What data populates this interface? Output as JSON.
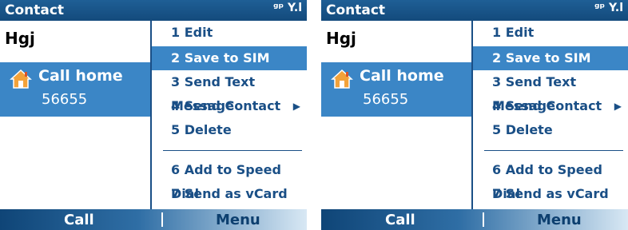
{
  "screens": [
    {
      "title": "Contact",
      "status": "ᵍᵖ Y.l",
      "contact_name": "Hgj",
      "selected_field": {
        "label": "Call home",
        "value": "56655",
        "icon": "home-icon"
      },
      "menu": {
        "items": [
          {
            "label": "1 Edit"
          },
          {
            "label": "2 Save to SIM"
          },
          {
            "label": "3 Send Text Message"
          },
          {
            "label": "4 Send Contact"
          },
          {
            "label": "5 Delete"
          },
          {
            "label": "6 Add to Speed Dial"
          },
          {
            "label": "7 Send as vCard"
          }
        ],
        "selected_index": 1
      },
      "softkeys": {
        "left": "Call",
        "right": "Menu"
      }
    },
    {
      "title": "Contact",
      "status": "ᵍᵖ Y.l",
      "contact_name": "Hgj",
      "selected_field": {
        "label": "Call home",
        "value": "56655",
        "icon": "home-icon"
      },
      "menu": {
        "items": [
          {
            "label": "1 Edit"
          },
          {
            "label": "2 Save to SIM"
          },
          {
            "label": "3 Send Text Message"
          },
          {
            "label": "4 Send Contact"
          },
          {
            "label": "5 Delete"
          },
          {
            "label": "6 Add to Speed Dial"
          },
          {
            "label": "7 Send as vCard"
          }
        ],
        "selected_index": 1
      },
      "softkeys": {
        "left": "Call",
        "right": "Menu"
      }
    }
  ],
  "colors": {
    "titlebar": "#134a7c",
    "highlight": "#3b86c6",
    "menu_text": "#1a4f86"
  }
}
